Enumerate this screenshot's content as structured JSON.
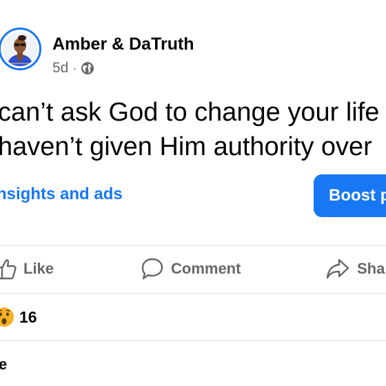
{
  "post": {
    "author": "Amber & DaTruth",
    "time": "5d",
    "separator": "·",
    "privacy_icon": "globe-icon",
    "text_lines": [
      "can’t ask God to change your life",
      "haven’t given Him authority over"
    ]
  },
  "promo": {
    "insights_label": "nsights and ads",
    "boost_label": "Boost p"
  },
  "actions": {
    "like": {
      "label": "Like",
      "icon": "thumbs-up-icon"
    },
    "comment": {
      "label": "Comment",
      "icon": "comment-bubble-icon"
    },
    "share": {
      "label": "Sha",
      "icon": "share-arrow-icon"
    }
  },
  "reactions": {
    "icon": "wow-emoji-icon",
    "count": "16"
  },
  "footer": {
    "text": "e"
  },
  "colors": {
    "accent": "#1877f2",
    "muted": "#65676b",
    "divider": "#dadde1",
    "emoji": "#f7b125"
  }
}
